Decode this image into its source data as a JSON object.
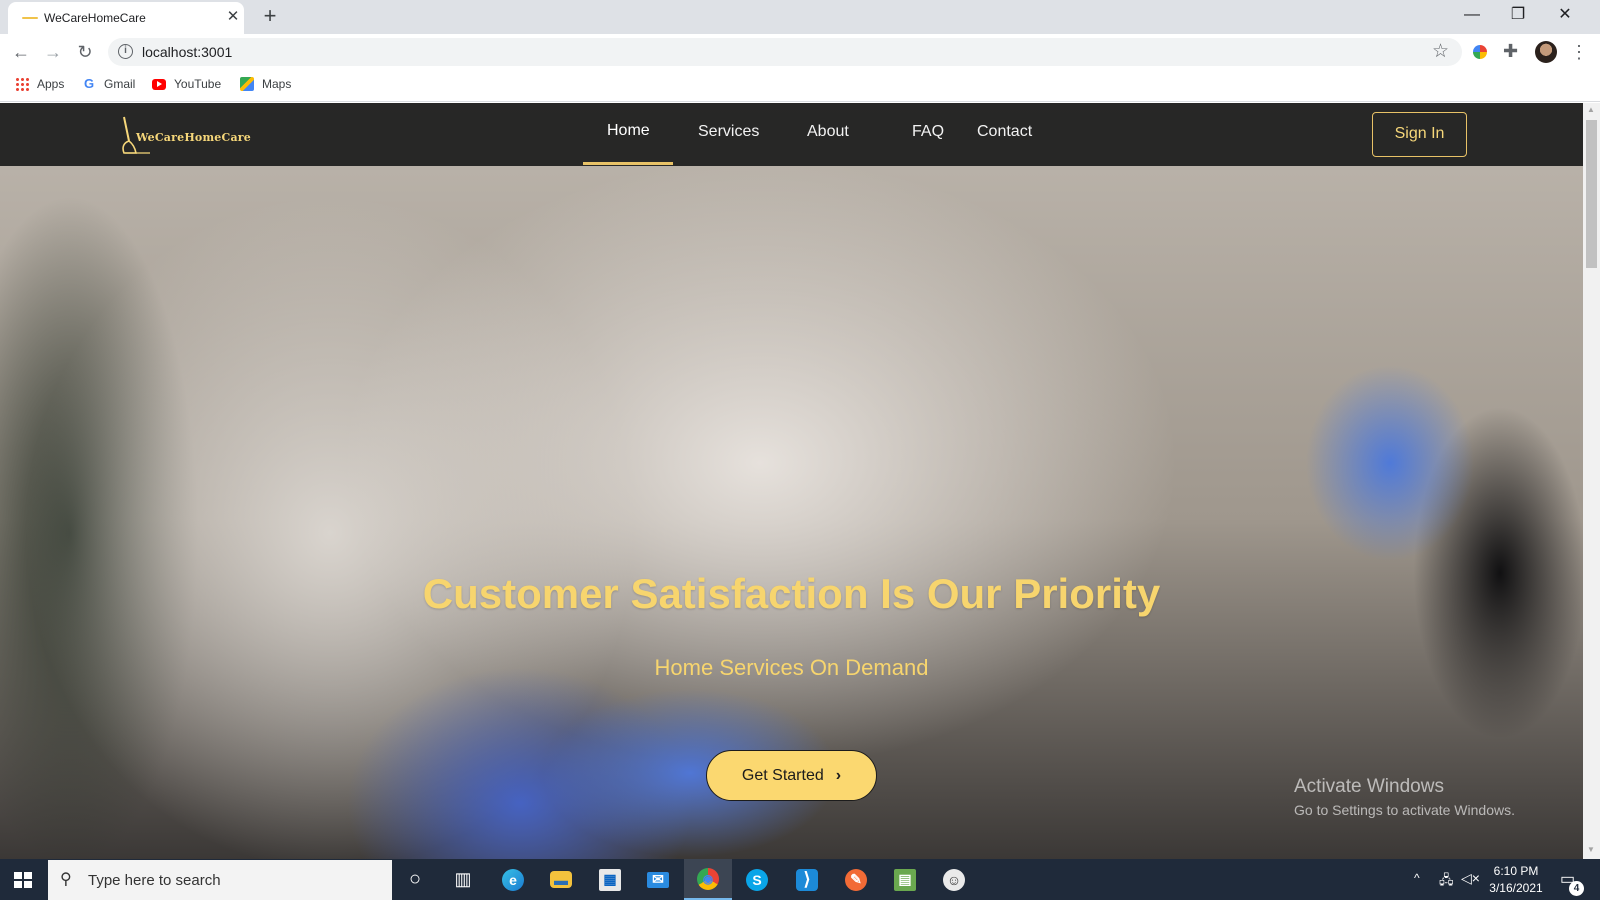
{
  "browser": {
    "tab_title": "WeCareHomeCare",
    "tab_close": "✕",
    "new_tab": "+",
    "controls": {
      "minimize": "—",
      "restore": "❐",
      "close": "✕"
    },
    "nav": {
      "back": "←",
      "forward": "→",
      "reload": "↻"
    },
    "info_icon": "i",
    "url": "localhost:3001",
    "star": "☆",
    "puzzle": "✚",
    "menu": "⋮",
    "bookmarks": [
      {
        "label": "Apps",
        "icon": "apps-grid-icon"
      },
      {
        "label": "Gmail",
        "icon": "gmail-icon"
      },
      {
        "label": "YouTube",
        "icon": "youtube-icon"
      },
      {
        "label": "Maps",
        "icon": "maps-icon"
      }
    ]
  },
  "site": {
    "logo_text": "WeCareHomeCare",
    "nav": [
      {
        "label": "Home",
        "active": true
      },
      {
        "label": "Services",
        "active": false
      },
      {
        "label": "About",
        "active": false
      },
      {
        "label": "FAQ",
        "active": false
      },
      {
        "label": "Contact",
        "active": false
      }
    ],
    "signin_label": "Sign In",
    "hero": {
      "title": "Customer Satisfaction Is Our Priority",
      "subtitle": "Home Services On Demand",
      "cta_label": "Get Started",
      "cta_chevron": "›"
    },
    "colors": {
      "accent": "#f7d56e",
      "nav_bg": "#1c1c1c",
      "button_fill": "#fbd870"
    }
  },
  "watermark": {
    "title": "Activate Windows",
    "subtitle": "Go to Settings to activate Windows."
  },
  "taskbar": {
    "search_placeholder": "Type here to search",
    "search_icon": "⚲",
    "apps": [
      {
        "name": "cortana-icon",
        "glyph": "○"
      },
      {
        "name": "task-view-icon",
        "glyph": "▥"
      },
      {
        "name": "edge-icon",
        "glyph": "e"
      },
      {
        "name": "file-explorer-icon",
        "glyph": "▬"
      },
      {
        "name": "store-icon",
        "glyph": "▦"
      },
      {
        "name": "mail-icon",
        "glyph": "✉"
      },
      {
        "name": "chrome-icon",
        "glyph": "◉"
      },
      {
        "name": "skype-icon",
        "glyph": "S"
      },
      {
        "name": "vscode-icon",
        "glyph": "⟩"
      },
      {
        "name": "postman-icon",
        "glyph": "✎"
      },
      {
        "name": "editor-icon",
        "glyph": "▤"
      },
      {
        "name": "github-desktop-icon",
        "glyph": "☺"
      }
    ],
    "tray_up": "^",
    "tray_net": "🖧",
    "tray_vol": "◁×",
    "time": "6:10 PM",
    "date": "3/16/2021",
    "notification_icon": "▭",
    "notification_count": "4"
  }
}
